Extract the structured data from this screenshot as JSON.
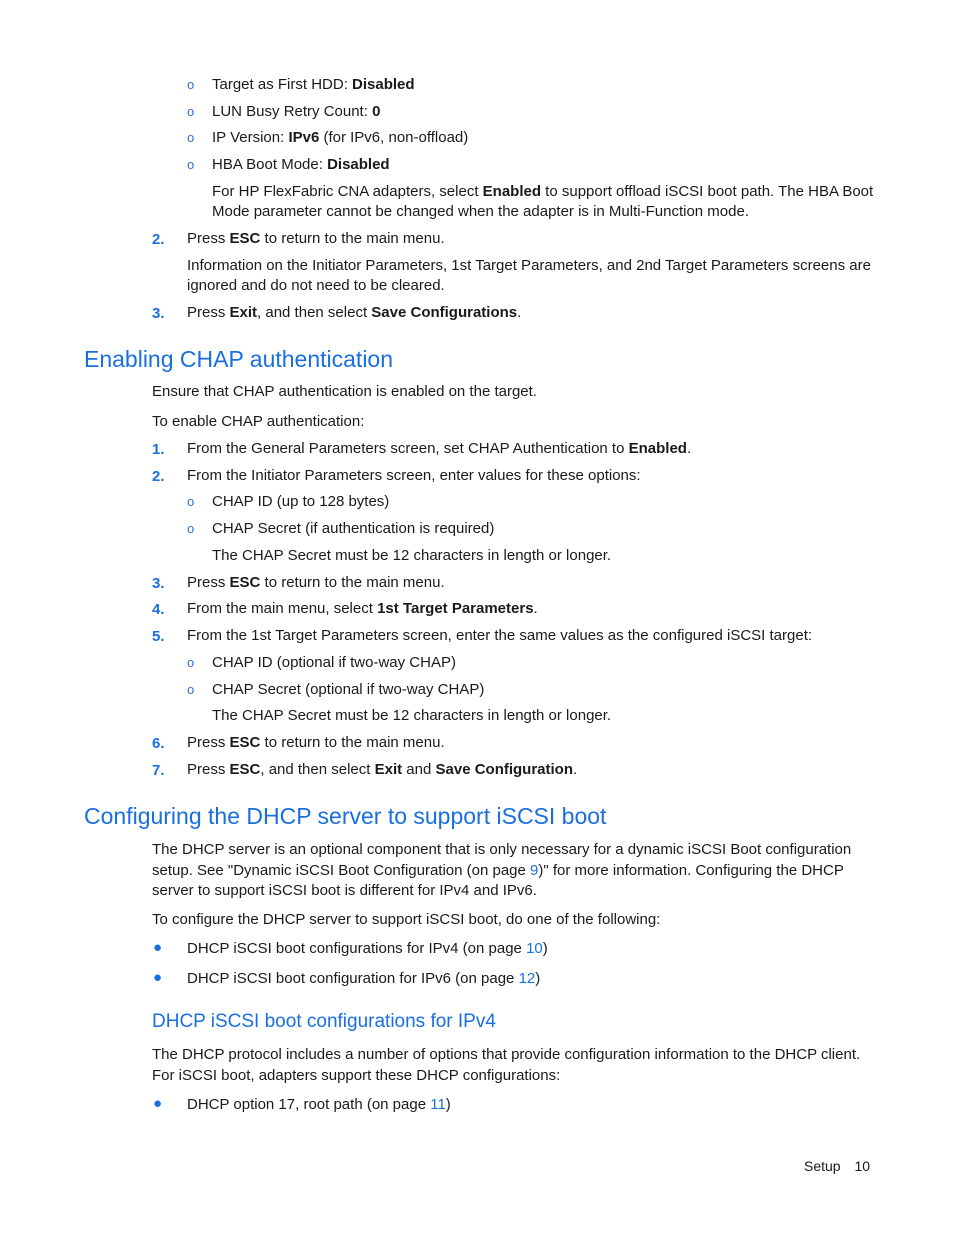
{
  "top_sub_items": [
    {
      "label": "Target as First HDD: ",
      "value": "Disabled",
      "suffix": ""
    },
    {
      "label": "LUN Busy Retry Count: ",
      "value": "0",
      "suffix": ""
    },
    {
      "label": "IP Version: ",
      "value": "IPv6",
      "suffix": " (for IPv6, non-offload)"
    },
    {
      "label": "HBA Boot Mode: ",
      "value": "Disabled",
      "suffix": ""
    }
  ],
  "hba_note": {
    "line1_a": "For HP FlexFabric CNA adapters, select ",
    "line1_b": "Enabled",
    "line1_c": " to support offload iSCSI boot path. The HBA Boot",
    "line2": "Mode parameter cannot be changed when the adapter is in Multi-Function mode."
  },
  "top_steps": [
    {
      "num": "2.",
      "a": "Press ",
      "b": "ESC",
      "c": " to return to the main menu."
    },
    {
      "num": "3.",
      "a": "Press ",
      "b": "Exit",
      "c": ", and then select ",
      "d": "Save Configurations",
      "e": "."
    }
  ],
  "step2_note": {
    "line1": "Information on the Initiator Parameters, 1st Target Parameters, and 2nd Target Parameters screens are",
    "line2": "ignored and do not need to be cleared."
  },
  "chap": {
    "heading": "Enabling CHAP authentication",
    "intro1": "Ensure that CHAP authentication is enabled on the target.",
    "intro2": "To enable CHAP authentication:",
    "steps": [
      {
        "num": "1.",
        "a": "From the General Parameters screen, set CHAP Authentication to ",
        "b": "Enabled",
        "c": "."
      },
      {
        "num": "2.",
        "a": "From the Initiator Parameters screen, enter values for these options:"
      },
      {
        "num": "3.",
        "a": "Press ",
        "b": "ESC",
        "c": " to return to the main menu."
      },
      {
        "num": "4.",
        "a": "From the main menu, select ",
        "b": "1st Target Parameters",
        "c": "."
      },
      {
        "num": "5.",
        "a": "From the 1st Target Parameters screen, enter the same values as the configured iSCSI target:"
      },
      {
        "num": "6.",
        "a": "Press ",
        "b": "ESC",
        "c": " to return to the main menu."
      },
      {
        "num": "7.",
        "a": "Press ",
        "b": "ESC",
        "c": ", and then select ",
        "d": "Exit",
        "e": " and ",
        "f": "Save Configuration",
        "g": "."
      }
    ],
    "step2_subs": [
      "CHAP ID (up to 128 bytes)",
      "CHAP Secret (if authentication is required)"
    ],
    "step5_subs": [
      "CHAP ID (optional if two-way CHAP)",
      "CHAP Secret (optional if two-way CHAP)"
    ],
    "secret_note": "The CHAP Secret must be 12 characters in length or longer."
  },
  "dhcp": {
    "heading": "Configuring the DHCP server to support iSCSI boot",
    "para_a": "The DHCP server is an optional component that is only necessary for a dynamic iSCSI Boot configuration setup. See \"Dynamic iSCSI Boot Configuration (on page ",
    "para_link": "9",
    "para_b": ")\" for more information. Configuring the DHCP server to support iSCSI boot is different for IPv4 and IPv6.",
    "intro": "To configure the DHCP server to support iSCSI boot, do one of the following:",
    "bullets": [
      {
        "text": "DHCP iSCSI boot configurations for IPv4 (on page ",
        "link": "10",
        "end": ")"
      },
      {
        "text": "DHCP iSCSI boot configuration for IPv6 (on page ",
        "link": "12",
        "end": ")"
      }
    ]
  },
  "ipv4": {
    "heading": "DHCP iSCSI boot configurations for IPv4",
    "para": "The DHCP protocol includes a number of options that provide configuration information to the DHCP client. For iSCSI boot, adapters support these DHCP configurations:",
    "bullets": [
      {
        "text": "DHCP option 17, root path (on page ",
        "link": "11",
        "end": ")"
      }
    ]
  },
  "footer": {
    "section": "Setup",
    "page": "10"
  }
}
